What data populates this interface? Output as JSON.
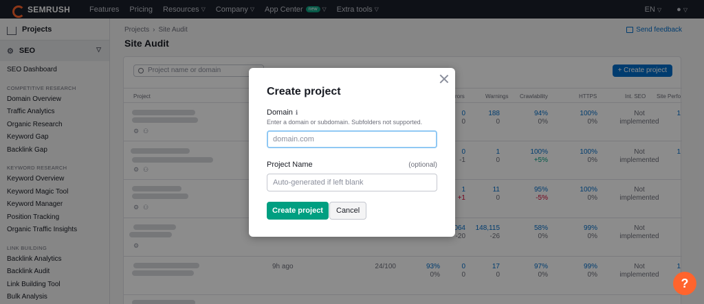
{
  "topnav": {
    "logo": "SEMRUSH",
    "items": [
      {
        "label": "Features",
        "dropdown": false
      },
      {
        "label": "Pricing",
        "dropdown": false
      },
      {
        "label": "Resources",
        "dropdown": true
      },
      {
        "label": "Company",
        "dropdown": true
      },
      {
        "label": "App Center",
        "dropdown": true,
        "badge": "new"
      },
      {
        "label": "Extra tools",
        "dropdown": true
      }
    ],
    "language": "EN",
    "user_icon": "user-icon"
  },
  "sidebar": {
    "projects": "Projects",
    "seo": "SEO",
    "dashboard": "SEO Dashboard",
    "sections": [
      {
        "heading": "COMPETITIVE RESEARCH",
        "items": [
          "Domain Overview",
          "Traffic Analytics",
          "Organic Research",
          "Keyword Gap",
          "Backlink Gap"
        ]
      },
      {
        "heading": "KEYWORD RESEARCH",
        "items": [
          "Keyword Overview",
          "Keyword Magic Tool",
          "Keyword Manager",
          "Position Tracking",
          "Organic Traffic Insights"
        ]
      },
      {
        "heading": "LINK BUILDING",
        "items": [
          "Backlink Analytics",
          "Backlink Audit",
          "Link Building Tool",
          "Bulk Analysis"
        ]
      }
    ]
  },
  "main": {
    "breadcrumb": [
      "Projects",
      "Site Audit"
    ],
    "title": "Site Audit",
    "feedback": "Send feedback",
    "search_placeholder": "Project name or domain",
    "create_button": "+ Create project",
    "columns": [
      "Project",
      "rors",
      "Warnings",
      "Crawlability",
      "HTTPS",
      "Int. SEO",
      "Site Perfo"
    ],
    "rows": [
      {
        "errors": "0",
        "errors_delta": "0",
        "warnings": "188",
        "warnings_delta": "0",
        "crawl": "94%",
        "crawl_delta": "0%",
        "https": "100%",
        "https_delta": "0%",
        "intseo": "Not implemented",
        "site": "1"
      },
      {
        "errors": "0",
        "errors_delta": "-1",
        "warnings": "1",
        "warnings_delta": "0",
        "crawl": "100%",
        "crawl_delta": "+5%",
        "https": "100%",
        "https_delta": "0%",
        "intseo": "Not implemented",
        "site": "1"
      },
      {
        "errors": "1",
        "errors_delta": "+1",
        "warnings": "11",
        "warnings_delta": "0",
        "crawl": "95%",
        "crawl_delta": "-5%",
        "https": "100%",
        "https_delta": "0%",
        "intseo": "Not implemented",
        "site": ""
      },
      {
        "errors": "064",
        "errors_delta": "-20",
        "warnings": "148,115",
        "warnings_delta": "-26",
        "crawl": "58%",
        "crawl_delta": "0%",
        "https": "99%",
        "https_delta": "0%",
        "intseo": "Not implemented",
        "site": ""
      },
      {
        "updated": "9h ago",
        "pages": "24/100",
        "health": "93%",
        "health_delta": "0%",
        "errors": "0",
        "errors_delta": "0",
        "warnings": "17",
        "warnings_delta": "0",
        "crawl": "97%",
        "crawl_delta": "0%",
        "https": "99%",
        "https_delta": "0%",
        "intseo": "Not implemented",
        "site": "1"
      }
    ]
  },
  "modal": {
    "title": "Create project",
    "domain_label": "Domain",
    "domain_hint": "Enter a domain or subdomain. Subfolders not supported.",
    "domain_placeholder": "domain.com",
    "name_label": "Project Name",
    "name_optional": "(optional)",
    "name_placeholder": "Auto-generated if left blank",
    "submit": "Create project",
    "cancel": "Cancel"
  },
  "help_button": "?",
  "colors": {
    "nav": "#1b1f2a",
    "brand": "#ff642d",
    "primary": "#009f81",
    "link": "#006dca"
  }
}
